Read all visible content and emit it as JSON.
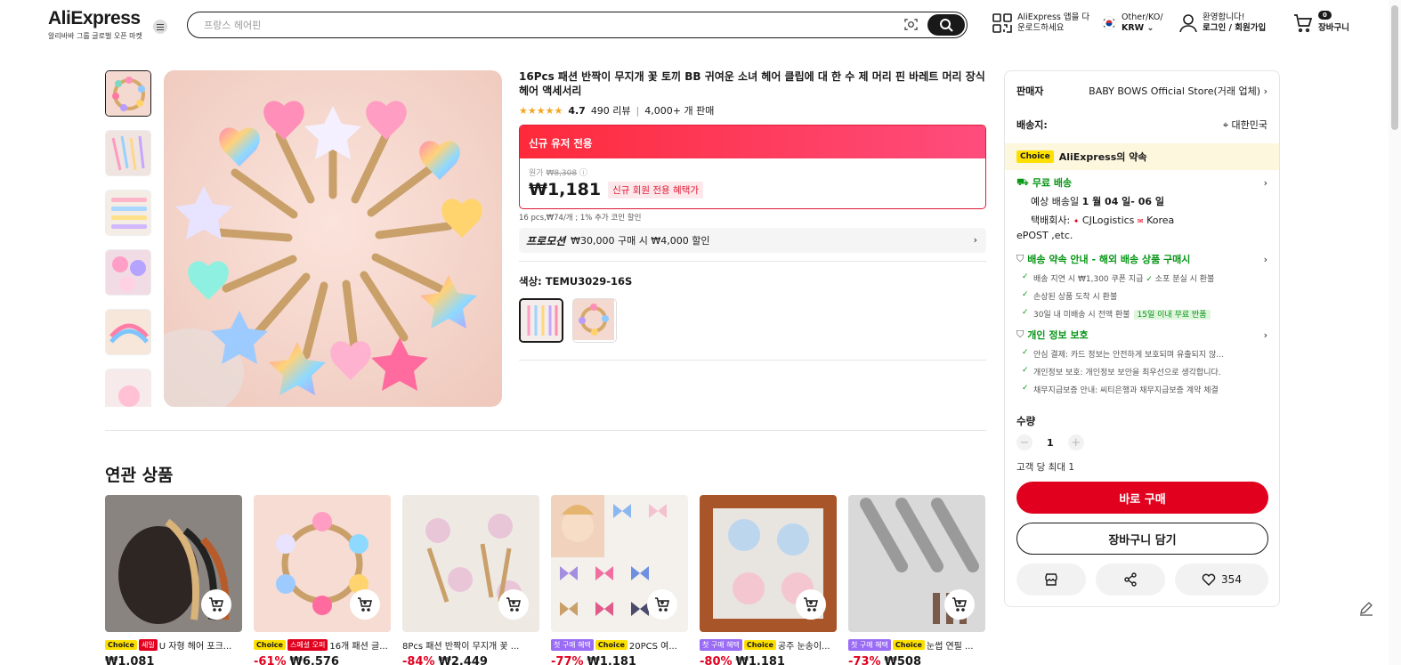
{
  "header": {
    "logo": "AliExpress",
    "logo_sub": "알리바바 그룹 글로벌 오픈 마켓",
    "search_placeholder": "프랑스 헤어핀",
    "app_line1": "AliExpress 앱을 다",
    "app_line2": "운로드하세요",
    "region_line1": "Other/KO/",
    "region_line2": "KRW",
    "account_line1": "환영합니다!",
    "account_line2": "로그인 / 회원가입",
    "cart_count": "0",
    "cart_label": "장바구니"
  },
  "product": {
    "title": "16Pcs 패션 반짝이 무지개 꽃 토끼 BB 귀여운 소녀 헤어 클립에 대 한 수 제 머리 핀 바레트 머리 장식 헤어 액세서리",
    "stars": "★★★★★",
    "rating": "4.7",
    "reviews": "490 리뷰",
    "sold": "4,000+ 개 판매",
    "deal_header": "신규 유저 전용",
    "orig_label": "원가",
    "orig_price": "₩8,308",
    "price": "₩1,181",
    "price_tag": "신규 회원 전용 혜택가",
    "unit_price": "16 pcs,₩74/개 ; 1% 추가 코인 할인",
    "promo_label": "프로모션",
    "promo_text": "₩30,000 구매 시 ₩4,000 할인",
    "color_label": "색상: TEMU3029-16S"
  },
  "panel": {
    "seller_label": "판매자",
    "seller_name": "BABY BOWS Official Store(거래 업체)",
    "ship_label": "배송지:",
    "ship_to": "대한민국",
    "choice_tag": "Choice",
    "choice_text": "AliExpress의 약속",
    "free_ship": "무료 배송",
    "eta_label": "예상 배송일",
    "eta_value": "1 월 04 일- 06 일",
    "carrier_label": "택배회사:",
    "carrier_cj": "CJLogistics",
    "carrier_korea": "Korea",
    "carrier_more": "ePOST ,etc.",
    "promise_title": "배송 약속 안내 - 해외 배송 상품 구매시",
    "promise_1a": "배송 지연 시 ₩1,300 쿠폰 지급",
    "promise_1b": "소포 분실 시 환불",
    "promise_2": "손상된 상품 도착 시 환불",
    "promise_3": "30일 내 미배송 시 전액 환불",
    "promise_3_badge": "15일 이내 무료 반품",
    "privacy_title": "개인 정보 보호",
    "privacy_1": "안심 결제: 카드 정보는 안전하게 보호되며 유출되지 않...",
    "privacy_2": "개인정보 보호: 개인정보 보안을 최우선으로 생각합니다.",
    "privacy_3": "채무지급보증 안내: 씨티은행과 채무지급보증 계약 체결",
    "qty_label": "수량",
    "qty_value": "1",
    "max_label": "고객 당 최대 1",
    "buy_now": "바로 구매",
    "add_cart": "장바구니 담기",
    "wish_count": "354"
  },
  "related": {
    "title": "연관 상품",
    "items": [
      {
        "tags": [
          "Choice",
          "세일"
        ],
        "name": "U 자형 헤어 포크...",
        "disc": "",
        "price": "₩1,081"
      },
      {
        "tags": [
          "Choice",
          "스페셜 오퍼"
        ],
        "name": "16개 패션 글...",
        "disc": "-61%",
        "price": "₩6,576"
      },
      {
        "tags": [],
        "name": "8Pcs 패션 반짝이 무지개 꽃 ...",
        "disc": "-84%",
        "price": "₩2,449"
      },
      {
        "tags": [
          "첫 구매 혜택",
          "Choice"
        ],
        "name": "20PCS 여...",
        "disc": "-77%",
        "price": "₩1,181"
      },
      {
        "tags": [
          "첫 구매 혜택",
          "Choice"
        ],
        "name": "공주 눈송이...",
        "disc": "-80%",
        "price": "₩1,181"
      },
      {
        "tags": [
          "첫 구매 혜택",
          "Choice"
        ],
        "name": "눈썹 연필 ...",
        "disc": "-73%",
        "price": "₩508"
      }
    ]
  },
  "colors": {
    "brand_red": "#e1011f",
    "deal_gradient_start": "#fe2a3b",
    "choice_yellow": "#fee000",
    "green": "#089617"
  }
}
